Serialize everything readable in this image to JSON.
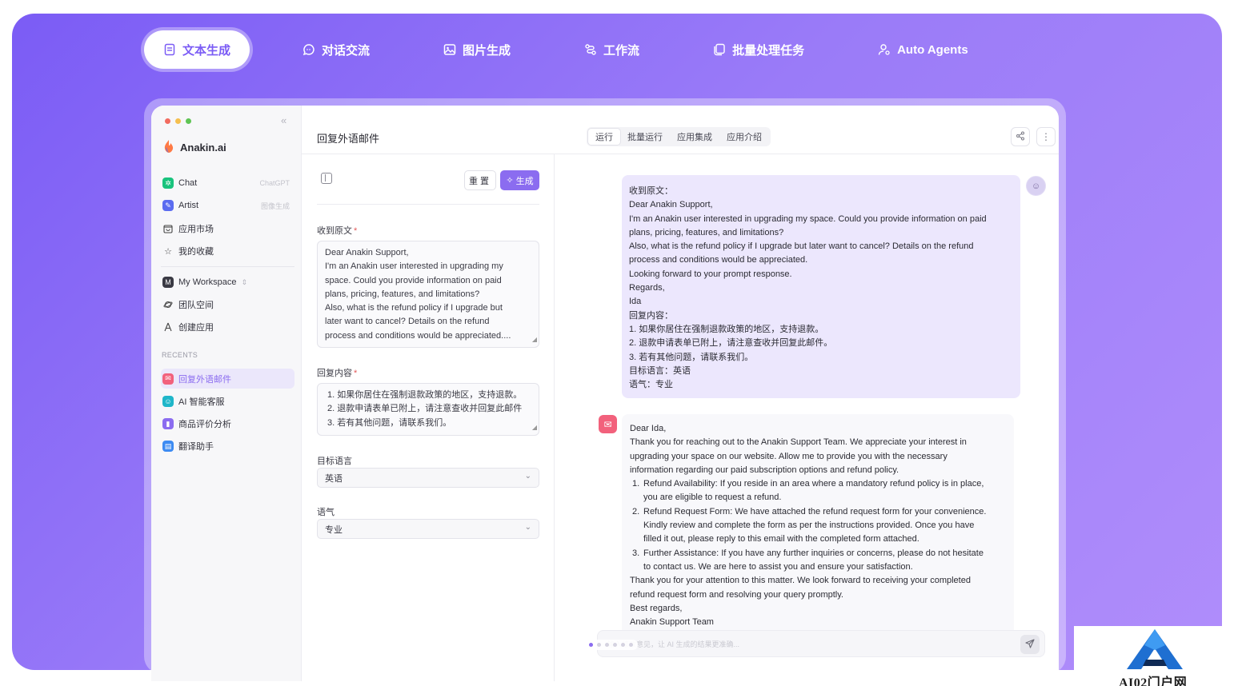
{
  "topnav": {
    "items": [
      {
        "label": "文本生成",
        "icon": "document-icon",
        "active": true
      },
      {
        "label": "对话交流",
        "icon": "chat-bubble-icon"
      },
      {
        "label": "图片生成",
        "icon": "image-icon"
      },
      {
        "label": "工作流",
        "icon": "workflow-icon"
      },
      {
        "label": "批量处理任务",
        "icon": "batch-icon"
      },
      {
        "label": "Auto Agents",
        "icon": "agent-icon"
      }
    ]
  },
  "sidebar": {
    "brand": "Anakin.ai",
    "items": [
      {
        "label": "Chat",
        "hint": "ChatGPT",
        "color": "#19c37d"
      },
      {
        "label": "Artist",
        "hint": "图像生成",
        "color": "#5b6cf0"
      },
      {
        "label": "应用市场",
        "icon": "store-icon"
      },
      {
        "label": "我的收藏",
        "icon": "star-icon"
      }
    ],
    "workspace": {
      "label": "My Workspace",
      "badge": "M"
    },
    "workspace_items": [
      {
        "label": "团队空间",
        "icon": "planet-icon"
      },
      {
        "label": "创建应用",
        "icon": "create-icon"
      }
    ],
    "recents_label": "RECENTS",
    "recents": [
      {
        "label": "回复外语邮件",
        "color": "#f2617c",
        "active": true
      },
      {
        "label": "AI 智能客服",
        "color": "#1fb6c9"
      },
      {
        "label": "商品评价分析",
        "color": "#8b6cf0"
      },
      {
        "label": "翻译助手",
        "color": "#3d8bf2"
      }
    ]
  },
  "header": {
    "title": "回复外语邮件",
    "tabs": [
      "运行",
      "批量运行",
      "应用集成",
      "应用介绍"
    ]
  },
  "form": {
    "reset_label": "重置",
    "generate_label": "生成",
    "original_label": "收到原文",
    "original_text": [
      "Dear Anakin Support,",
      "I'm an Anakin user interested in upgrading my",
      "space. Could you provide information on paid",
      "plans, pricing, features, and limitations?",
      "Also, what is the refund policy if I upgrade but",
      "later want to cancel? Details on the refund",
      "process and conditions would be appreciated...."
    ],
    "reply_label": "回复内容",
    "reply_text": [
      "1. 如果你居住在强制退款政策的地区，支持退款。",
      "2. 退款申请表单已附上，请注意查收并回复此邮件",
      "3. 若有其他问题，请联系我们。"
    ],
    "lang_label": "目标语言",
    "lang_value": "英语",
    "tone_label": "语气",
    "tone_value": "专业"
  },
  "chat": {
    "user_lines": [
      "收到原文：",
      "Dear Anakin Support,",
      "I'm an Anakin user interested in upgrading my space. Could you provide information on paid",
      "plans, pricing, features, and limitations?",
      "Also, what is the refund policy if I upgrade but later want to cancel? Details on the refund",
      "process and conditions would be appreciated.",
      "Looking forward to your prompt response.",
      "Regards,",
      "Ida",
      "回复内容：",
      "1. 如果你居住在强制退款政策的地区，支持退款。",
      "2. 退款申请表单已附上，请注意查收并回复此邮件。",
      "3. 若有其他问题，请联系我们。",
      "目标语言：英语",
      "语气：专业"
    ],
    "bot_intro": [
      "Dear Ida,",
      "Thank you for reaching out to the Anakin Support Team. We appreciate your interest in",
      "upgrading your space on our website. Allow me to provide you with the necessary",
      "information regarding our paid subscription options and refund policy."
    ],
    "bot_list": [
      {
        "num": "1.",
        "lines": [
          "Refund Availability: If you reside in an area where a mandatory refund policy is in place,",
          "you are eligible to request a refund."
        ]
      },
      {
        "num": "2.",
        "lines": [
          "Refund Request Form: We have attached the refund request form for your convenience.",
          "Kindly review and complete the form as per the instructions provided. Once you have",
          "filled it out, please reply to this email with the completed form attached."
        ]
      },
      {
        "num": "3.",
        "lines": [
          "Further Assistance: If you have any further inquiries or concerns, please do not hesitate",
          "to contact us. We are here to assist you and ensure your satisfaction."
        ]
      }
    ],
    "bot_outro": [
      "Thank you for your attention to this matter. We look forward to receiving your completed",
      "refund request form and resolving your query promptly.",
      "Best regards,",
      "Anakin Support Team"
    ],
    "composer_placeholder": "输入修改意见，让 AI 生成的结果更准确..."
  },
  "watermark": {
    "text": "AI02门户网"
  }
}
